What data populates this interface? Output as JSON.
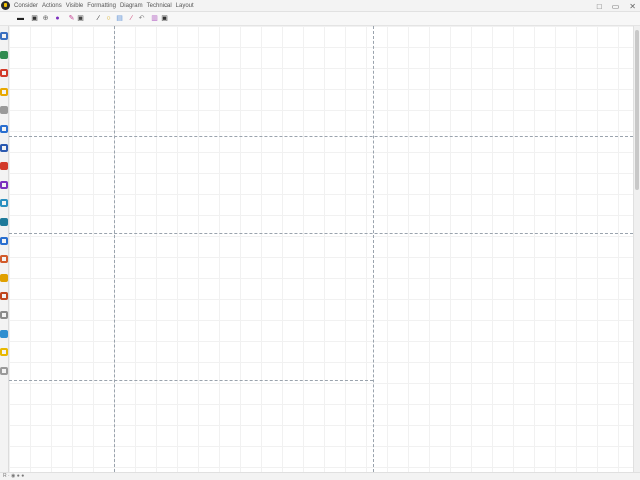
{
  "menubar": {
    "items": [
      "Consider",
      "Actions",
      "Visible",
      "Formatting",
      "Diagram",
      "Technical",
      "Layout"
    ],
    "extra": "○"
  },
  "window_controls": [
    "□",
    "▭",
    "✕"
  ],
  "toolbar": {
    "buttons": [
      {
        "name": "undo-icon",
        "glyph": "▬",
        "color": "#222222"
      },
      {
        "name": "save-icon",
        "glyph": "▣",
        "color": "#333333"
      },
      {
        "name": "zoom-icon",
        "glyph": "⊕",
        "color": "#666666"
      },
      {
        "name": "shape-icon",
        "glyph": "●",
        "color": "#7b2fbe"
      },
      {
        "name": "pen-icon",
        "glyph": "✎",
        "color": "#c23a8e"
      },
      {
        "name": "format-icon",
        "glyph": "▣",
        "color": "#444444"
      },
      {
        "name": "line-icon",
        "glyph": "∕",
        "color": "#222222"
      },
      {
        "name": "search-icon",
        "glyph": "○",
        "color": "#d6a400"
      },
      {
        "name": "image-icon",
        "glyph": "▤",
        "color": "#5a8fd6"
      },
      {
        "name": "curve-icon",
        "glyph": "∕",
        "color": "#cc3a6f"
      },
      {
        "name": "rotate-icon",
        "glyph": "↶",
        "color": "#888888"
      },
      {
        "name": "link-icon",
        "glyph": "▥",
        "color": "#b05ac0"
      },
      {
        "name": "frame-icon",
        "glyph": "▣",
        "color": "#333333"
      }
    ]
  },
  "tool_rail": {
    "icons": [
      {
        "name": "arrow-tool-icon",
        "color": "#3a6fbf"
      },
      {
        "name": "shapes-tool-icon",
        "color": "#2f8a4f"
      },
      {
        "name": "record-tool-icon",
        "color": "#d23a2a"
      },
      {
        "name": "note-tool-icon",
        "color": "#e8a800"
      },
      {
        "name": "comment-tool-icon",
        "color": "#9a9a9a"
      },
      {
        "name": "globe-tool-icon",
        "color": "#2a6fd0"
      },
      {
        "name": "slides-tool-icon",
        "color": "#2c5ab0"
      },
      {
        "name": "table-tool-icon",
        "color": "#d23a2a"
      },
      {
        "name": "tag-tool-icon",
        "color": "#7b2fbe"
      },
      {
        "name": "process-tool-icon",
        "color": "#2a8fbf"
      },
      {
        "name": "chat-tool-icon",
        "color": "#1f7a9a"
      },
      {
        "name": "link-tool-icon",
        "color": "#2a6fd0"
      },
      {
        "name": "folder-tool-icon",
        "color": "#d25a2a"
      },
      {
        "name": "note2-tool-icon",
        "color": "#e0a000"
      },
      {
        "name": "brick-tool-icon",
        "color": "#c0461e"
      },
      {
        "name": "marker-tool-icon",
        "color": "#8a8a8a"
      },
      {
        "name": "brush-tool-icon",
        "color": "#2f8fd0"
      },
      {
        "name": "bulb-tool-icon",
        "color": "#e8b800"
      },
      {
        "name": "more-tool-icon",
        "color": "#9a9a9a"
      }
    ]
  },
  "status": {
    "text": "R · ◉ ● ●"
  }
}
